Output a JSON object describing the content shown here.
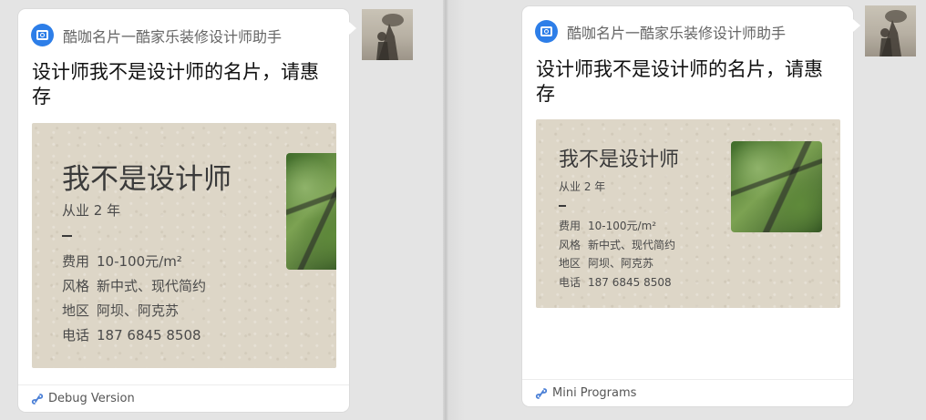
{
  "cards": [
    {
      "app_name": "酷咖名片一酷家乐装修设计师助手",
      "message_title": "设计师我不是设计师的名片，请惠存",
      "card": {
        "title": "我不是设计师",
        "years": "从业 2 年",
        "rows": [
          {
            "label": "费用",
            "value": "10-100元/m²"
          },
          {
            "label": "风格",
            "value": "新中式、现代简约"
          },
          {
            "label": "地区",
            "value": "阿坝、阿克苏"
          },
          {
            "label": "电话",
            "value": "187 6845 8508"
          }
        ]
      },
      "footer": "Debug Version"
    },
    {
      "app_name": "酷咖名片一酷家乐装修设计师助手",
      "message_title": "设计师我不是设计师的名片，请惠存",
      "card": {
        "title": "我不是设计师",
        "years": "从业 2 年",
        "rows": [
          {
            "label": "费用",
            "value": "10-100元/m²"
          },
          {
            "label": "风格",
            "value": "新中式、现代简约"
          },
          {
            "label": "地区",
            "value": "阿坝、阿克苏"
          },
          {
            "label": "电话",
            "value": "187 6845 8508"
          }
        ]
      },
      "footer": "Mini Programs"
    }
  ],
  "icons": {
    "app": "camera-icon",
    "footer": "mini-program-link-icon"
  },
  "colors": {
    "app_icon": "#2d7ee8",
    "card_bg": "#ddd6c7",
    "chat_bg": "#e4e4e4"
  }
}
